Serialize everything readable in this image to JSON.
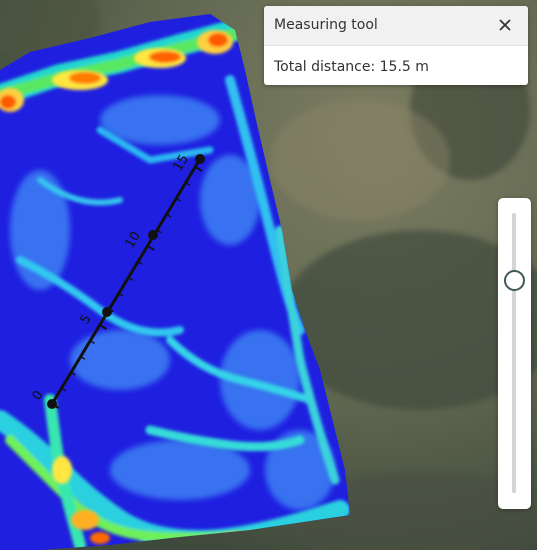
{
  "measuring_tool": {
    "title": "Measuring tool",
    "close_icon": "close-icon",
    "total_distance": "Total distance: 15.5 m"
  },
  "measurement": {
    "tick_labels": [
      "0",
      "5",
      "10",
      "15"
    ],
    "distance_m": 15.5
  },
  "opacity_slider": {
    "value_fraction": 0.78
  },
  "colors": {
    "measure_line": "#111111",
    "panel_background": "#ffffff",
    "heatmap_low": "#1a1ae6",
    "heatmap_high": "#ff5a00"
  }
}
